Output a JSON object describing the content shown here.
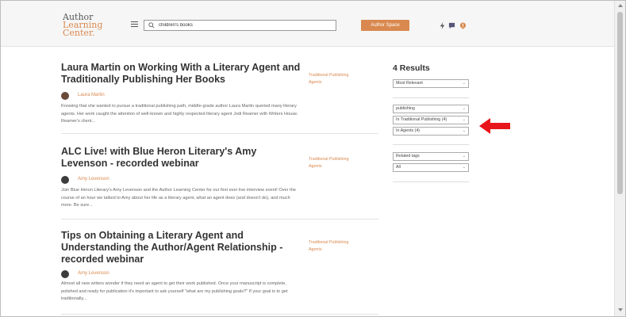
{
  "header": {
    "logo_lines": [
      "Author",
      "Learning",
      "Center."
    ],
    "search_value": "children's books",
    "author_space": "Author Space"
  },
  "results_label": "4 Results",
  "filters": {
    "sort": "Most Relevant",
    "keyword": "publishing",
    "category": "In Traditional Publishing (4)",
    "subcategory": "In Agents (4)",
    "tags_label": "Related tags",
    "tags_value": "All"
  },
  "articles": [
    {
      "title": "Laura Martin on Working With a Literary Agent and Traditionally Publishing Her Books",
      "author": "Laura Martin",
      "tag_lines": [
        "Traditional Publishing",
        "Agents"
      ],
      "excerpt": "Knowing that she wanted to pursue a traditional publishing path, middle-grade author Laura Martin queried many literary agents. Her work caught the attention of well-known and highly respected literary agent Jodi Reamer with Writers House. Reamer's client..."
    },
    {
      "title": "ALC Live! with Blue Heron Literary's Amy Levenson - recorded webinar",
      "author": "Amy Levenson",
      "tag_lines": [
        "Traditional Publishing",
        "Agents"
      ],
      "excerpt": "Join Blue Heron Literary's Amy Levenson and the Author Learning Center for our first ever live interview event! Over the course of an hour we talked to Amy about her life as a literary agent, what an agent does (and doesn't do), and much more. Be sure..."
    },
    {
      "title": "Tips on Obtaining a Literary Agent and Understanding the Author/Agent Relationship - recorded webinar",
      "author": "Amy Levenson",
      "tag_lines": [
        "Traditional Publishing",
        "Agents"
      ],
      "excerpt": "Almost all new writers wonder if they need an agent to get their work published. Once your manuscript is complete, polished and ready for publication it's important to ask yourself \"what are my publishing goals?\" If your goal is to get traditionally..."
    }
  ],
  "colors": {
    "accent": "#d9894f",
    "annotation_arrow": "#e8161b"
  },
  "icons": [
    "menu-icon",
    "search-icon",
    "lightning-icon",
    "chat-icon",
    "notification-icon"
  ]
}
